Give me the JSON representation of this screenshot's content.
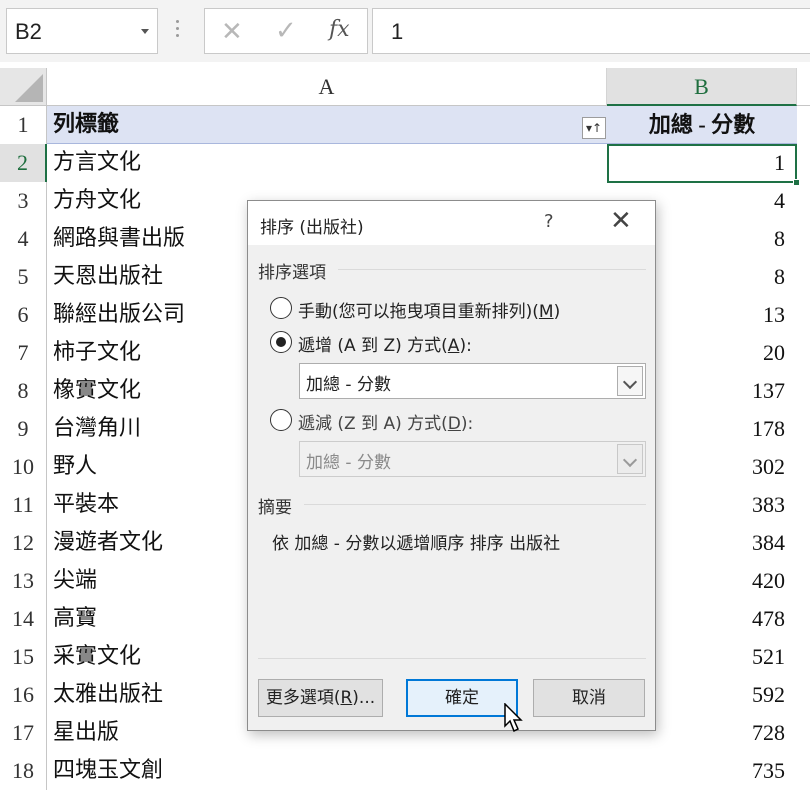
{
  "formula_bar": {
    "name_box": "B2",
    "cancel_glyph": "✕",
    "enter_glyph": "✓",
    "fx_label": "fx",
    "formula_value": "1"
  },
  "columns": {
    "a": "A",
    "b": "B"
  },
  "header_row": {
    "row": "1",
    "a": "列標籤",
    "b": "加總 - 分數",
    "sort_glyph": "▾↑"
  },
  "rows": [
    {
      "row": "2",
      "a": "方言文化",
      "b": "1"
    },
    {
      "row": "3",
      "a": "方舟文化",
      "b": "4"
    },
    {
      "row": "4",
      "a": "網路與書出版",
      "b": "8"
    },
    {
      "row": "5",
      "a": "天恩出版社",
      "b": "8"
    },
    {
      "row": "6",
      "a": "聯經出版公司",
      "b": "13"
    },
    {
      "row": "7",
      "a": "柿子文化",
      "b": "20"
    },
    {
      "row": "8",
      "a": "橡實文化",
      "b": "137"
    },
    {
      "row": "9",
      "a": "台灣角川",
      "b": "178"
    },
    {
      "row": "10",
      "a": "野人",
      "b": "302"
    },
    {
      "row": "11",
      "a": "平裝本",
      "b": "383"
    },
    {
      "row": "12",
      "a": "漫遊者文化",
      "b": "384"
    },
    {
      "row": "13",
      "a": "尖端",
      "b": "420"
    },
    {
      "row": "14",
      "a": "高寶",
      "b": "478"
    },
    {
      "row": "15",
      "a": "采實文化",
      "b": "521"
    },
    {
      "row": "16",
      "a": "太雅出版社",
      "b": "592"
    },
    {
      "row": "17",
      "a": "星出版",
      "b": "728"
    },
    {
      "row": "18",
      "a": "四塊玉文創",
      "b": "735"
    }
  ],
  "dialog": {
    "title": "排序 (出版社)",
    "help": "?",
    "close": "✕",
    "options_group": "排序選項",
    "manual": {
      "label": "手動(您可以拖曳項目重新排列)(",
      "key": "M",
      "end": ")"
    },
    "ascending": {
      "label": "遞增 (A 到 Z) 方式(",
      "key": "A",
      "end": "):",
      "value": "加總 - 分數"
    },
    "descending": {
      "label": "遞減 (Z 到 A) 方式(",
      "key": "D",
      "end": "):",
      "value": "加總 - 分數"
    },
    "summary_group": "摘要",
    "summary_text": "依 加總 - 分數以遞增順序 排序 出版社",
    "more_button": {
      "label": "更多選項(",
      "key": "R",
      "end": ")..."
    },
    "ok_button": "確定",
    "cancel_button": "取消"
  }
}
